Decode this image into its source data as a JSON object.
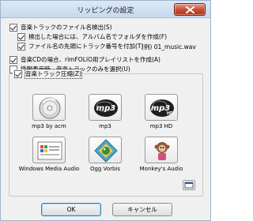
{
  "window": {
    "title": "リッピングの設定"
  },
  "options": {
    "filename_check": {
      "label": "音楽トラックのファイル名検出(S)",
      "checked": true
    },
    "album_folder": {
      "label": "検出した場合には、アルバム名でフォルダを作成(F)",
      "checked": true
    },
    "track_number": {
      "label": "ファイル名の先頭にトラック番号を付加(T)",
      "checked": true
    },
    "track_number_example": "(例) 01_music.wav",
    "playlist": {
      "label": "音楽CDの場合、rimFOLIO用プレイリストを作成(A)",
      "checked": true
    },
    "info_only": {
      "label": "情報表示時、音楽トラックのみを選択(U)",
      "checked": false
    }
  },
  "compression": {
    "label": "音楽トラック圧縮(Z)",
    "checked": true,
    "encoders": [
      {
        "label": "mp3 by acm",
        "icon": "mp3-compact-disc"
      },
      {
        "label": "mp3",
        "icon": "mp3-logo"
      },
      {
        "label": "mp3 HD",
        "icon": "mp3-hd-logo"
      },
      {
        "label": "Windows Media Audio",
        "icon": "windows-media-audio"
      },
      {
        "label": "Ogg Vorbis",
        "icon": "ogg-vorbis"
      },
      {
        "label": "Monkey's Audio",
        "icon": "monkeys-audio"
      }
    ]
  },
  "buttons": {
    "ok": "OK",
    "cancel": "キャンセル"
  },
  "colors": {
    "title_bar": "#c7d9ef",
    "close_button": "#c44a2e",
    "dialog_bg": "#f0f0f0"
  }
}
